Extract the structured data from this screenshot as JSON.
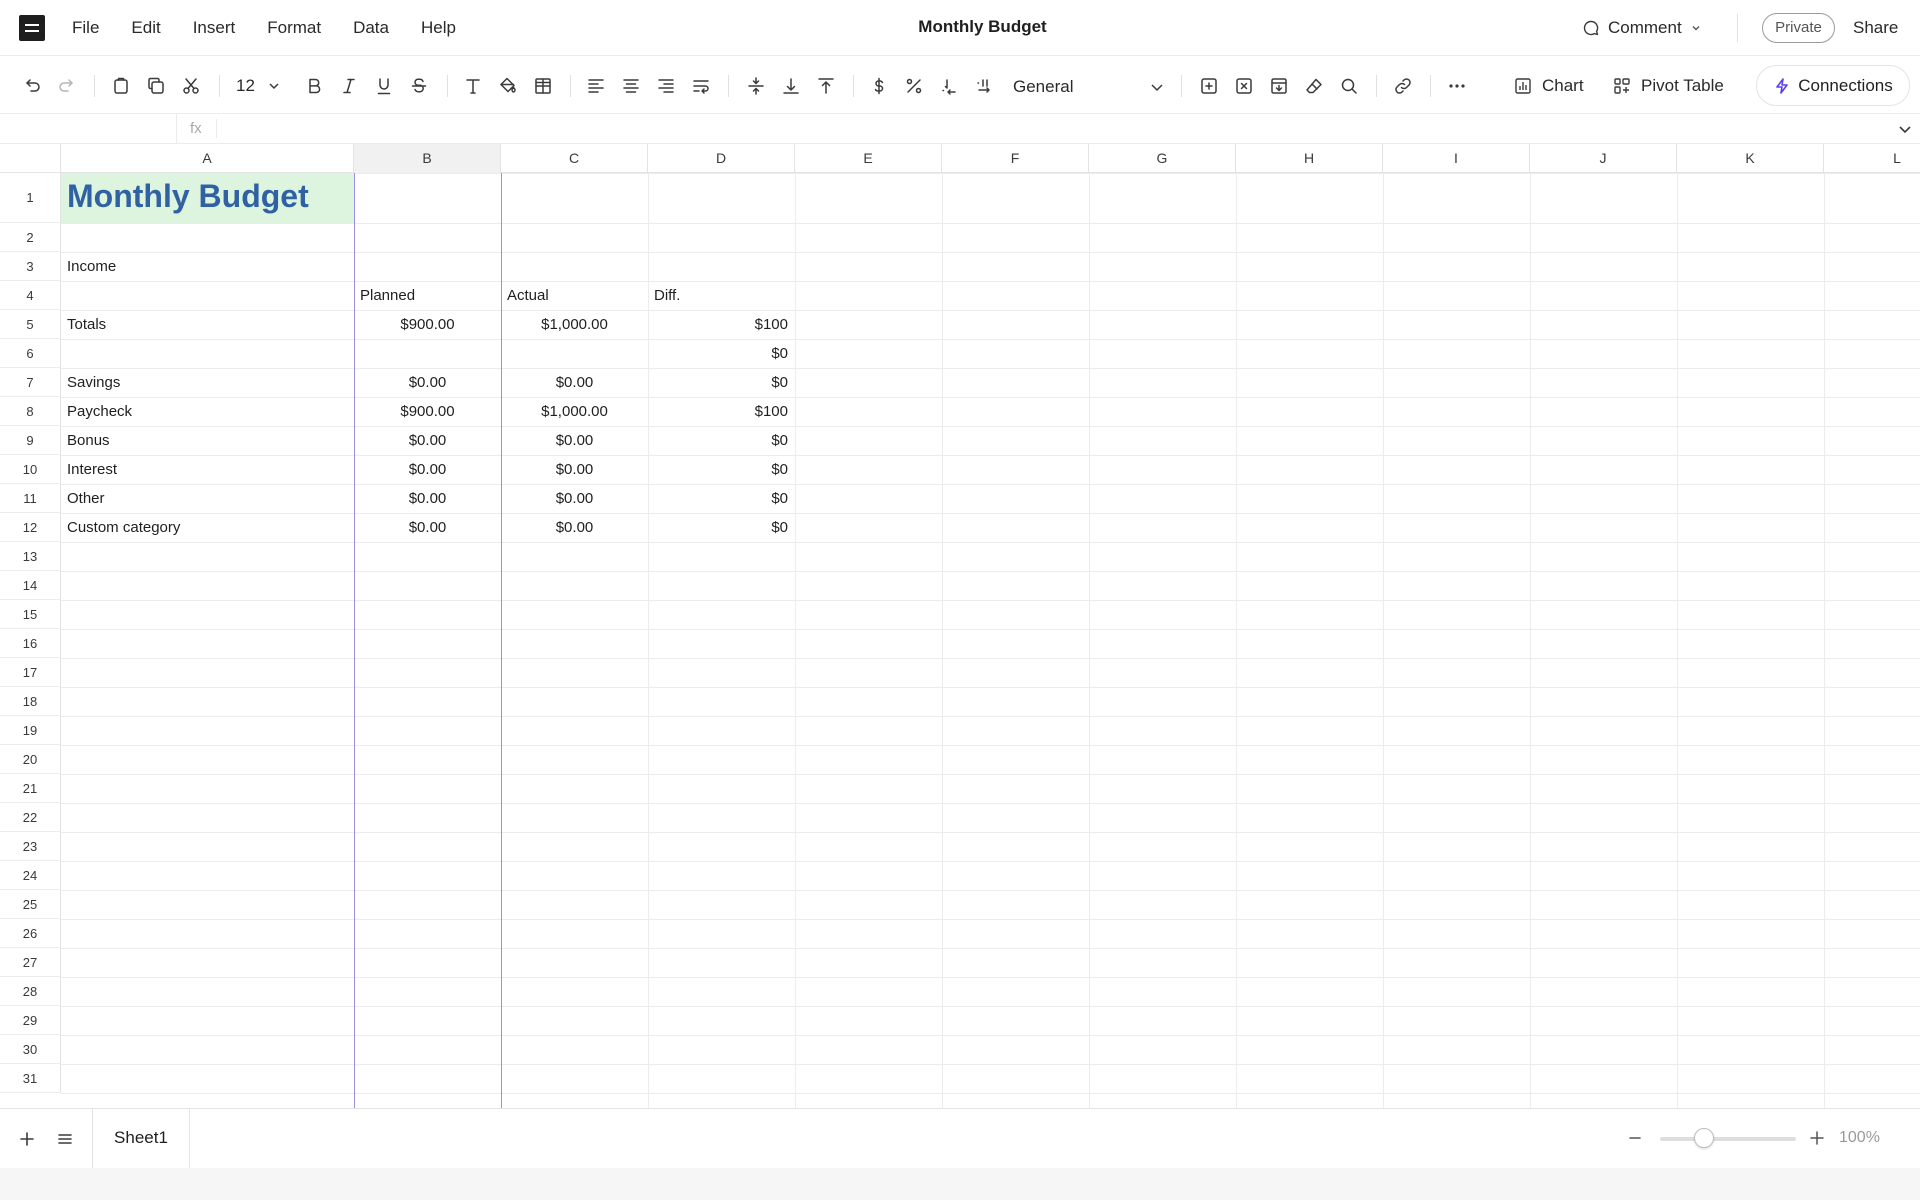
{
  "app": {
    "document_title": "Monthly Budget",
    "menu": [
      "File",
      "Edit",
      "Insert",
      "Format",
      "Data",
      "Help"
    ],
    "comment_label": "Comment",
    "private_label": "Private",
    "share_label": "Share"
  },
  "toolbar": {
    "font_size": "12",
    "number_format": "General",
    "chart_label": "Chart",
    "pivot_label": "Pivot Table",
    "connections_label": "Connections",
    "accent_color": "#5b3ef0"
  },
  "formula_bar": {
    "fx_label": "fx",
    "cell_ref": "",
    "formula": ""
  },
  "grid": {
    "columns": [
      "A",
      "B",
      "C",
      "D",
      "E",
      "F",
      "G",
      "H",
      "I",
      "J",
      "K",
      "L"
    ],
    "selected_column": "B",
    "rows": [
      "1",
      "2",
      "3",
      "4",
      "5",
      "6",
      "7",
      "8",
      "9",
      "10",
      "11",
      "12",
      "13",
      "14",
      "15",
      "16",
      "17",
      "18",
      "19",
      "20",
      "21",
      "22",
      "23",
      "24",
      "25",
      "26",
      "27",
      "28",
      "29",
      "30",
      "31"
    ],
    "title": "Monthly Budget",
    "title_color": "#2f61a4",
    "title_fill": "#ddf5df",
    "section_label": "Income",
    "headers": {
      "planned": "Planned",
      "actual": "Actual",
      "diff": "Diff."
    },
    "totals": {
      "label": "Totals",
      "planned": "$900.00",
      "actual": "$1,000.00",
      "diff": "$100"
    },
    "row6_diff": "$0",
    "items": [
      {
        "label": "Savings",
        "planned": "$0.00",
        "actual": "$0.00",
        "diff": "$0"
      },
      {
        "label": "Paycheck",
        "planned": "$900.00",
        "actual": "$1,000.00",
        "diff": "$100"
      },
      {
        "label": "Bonus",
        "planned": "$0.00",
        "actual": "$0.00",
        "diff": "$0"
      },
      {
        "label": "Interest",
        "planned": "$0.00",
        "actual": "$0.00",
        "diff": "$0"
      },
      {
        "label": "Other",
        "planned": "$0.00",
        "actual": "$0.00",
        "diff": "$0"
      },
      {
        "label": "Custom category",
        "planned": "$0.00",
        "actual": "$0.00",
        "diff": "$0"
      }
    ]
  },
  "footer": {
    "sheet_name": "Sheet1",
    "zoom": "100%"
  }
}
